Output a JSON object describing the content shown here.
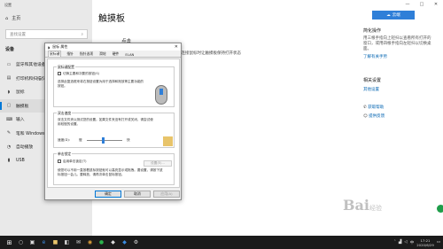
{
  "window": {
    "title": "设置",
    "controls": [
      "—",
      "□",
      "✕"
    ]
  },
  "sidebar": {
    "home": "主页",
    "search_placeholder": "查找设置",
    "group": "设备",
    "items": [
      {
        "label": "蓝牙和其他设备",
        "icon": "bluetooth-icon"
      },
      {
        "label": "打印机和扫描仪",
        "icon": "printer-icon"
      },
      {
        "label": "鼠标",
        "icon": "mouse-icon"
      },
      {
        "label": "触摸板",
        "icon": "touchpad-icon"
      },
      {
        "label": "输入",
        "icon": "keyboard-icon"
      },
      {
        "label": "笔和 Windows Ink",
        "icon": "pen-icon"
      },
      {
        "label": "自动播放",
        "icon": "autoplay-icon"
      },
      {
        "label": "USB",
        "icon": "usb-icon"
      }
    ]
  },
  "content": {
    "title": "触摸板",
    "subtitle": "点击",
    "text": "在连接鼠标时让触摸板保持打开状态"
  },
  "badge": {
    "label": "云端"
  },
  "right_panel": {
    "quick_title": "简化操作",
    "quick_body": "用三根手指向上轻扫以查看所有打开的窗口，或用四根手指向左轻扫以切换桌面。",
    "quick_link": "了解有关手势",
    "related_title": "相关设置",
    "related_link": "其他设置",
    "help_link": "获取帮助",
    "feedback_link": "提供反馈"
  },
  "dialog": {
    "title": "鼠标 属性",
    "tabs": [
      "鼠标键",
      "指针",
      "指针选项",
      "滑轮",
      "硬件",
      "ELAN"
    ],
    "button_config": {
      "group_label": "鼠标键配置",
      "checkbox_label": "切换主要和次要的按钮(S)",
      "description": "选择此复选框来将右按钮设置为用于选择和拖放等主要功能的按钮。"
    },
    "double_click": {
      "group_label": "双击速度",
      "description": "双击文件夹以测试您的设置。如果文件夹没有打开或关闭，请尝试使用较慢的设置。",
      "speed_label": "速度(D):",
      "slow": "慢",
      "fast": "快",
      "speed_value": 0.45
    },
    "click_lock": {
      "group_label": "单击锁定",
      "checkbox_label": "启用单击锁定(T)",
      "settings_button": "设置(E)...",
      "description": "使您可以不用一直按着鼠标按钮就可以高亮显示或拖拽。要设置，请按下鼠标按钮一会儿。要释放，请再次单击鼠标按钮。"
    },
    "buttons": {
      "ok": "确定",
      "cancel": "取消",
      "apply": "应用(A)"
    }
  },
  "taskbar": {
    "icons": [
      "search-icon",
      "task-view-icon",
      "edge-icon",
      "explorer-icon",
      "store-icon",
      "mail-icon",
      "chrome-icon",
      "wechat-icon",
      "app-icon",
      "app-icon",
      "app-icon"
    ],
    "time": "17:21",
    "date": "2020/6/29"
  },
  "watermark": {
    "text": "Bai",
    "sub": "经验"
  }
}
